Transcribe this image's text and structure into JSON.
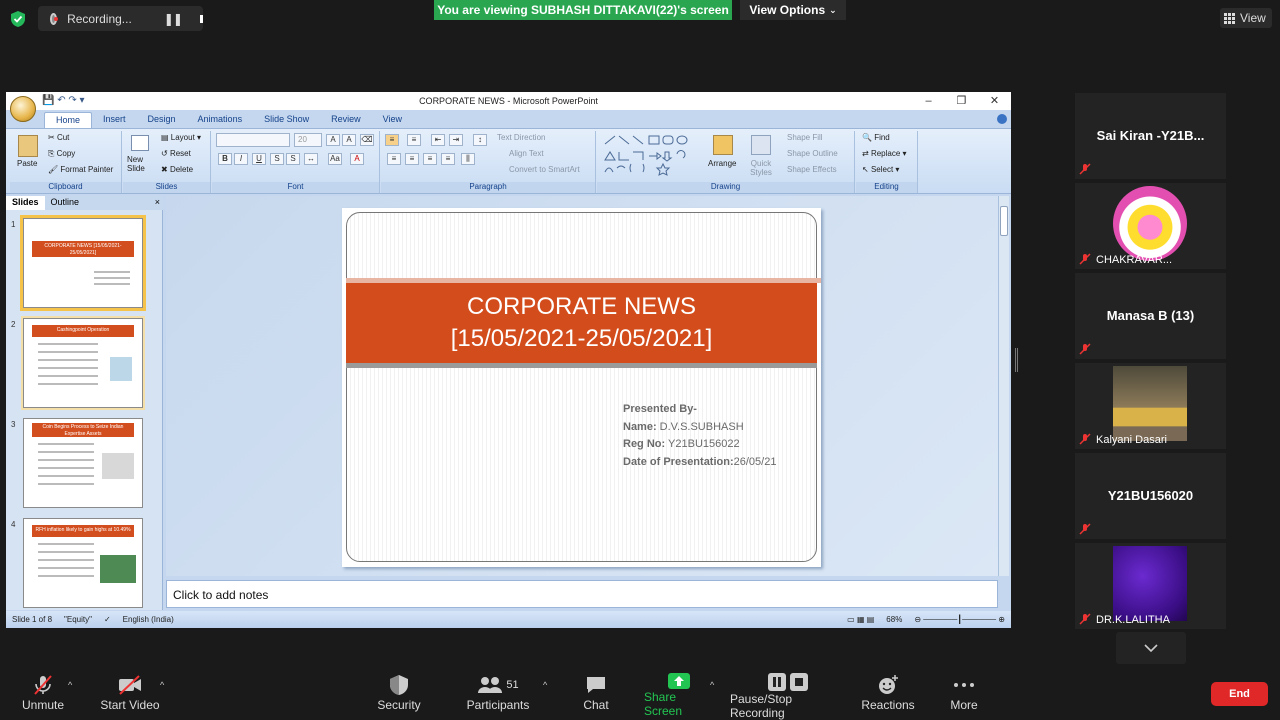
{
  "top": {
    "recording_label": "Recording...",
    "banner": "You are viewing SUBHASH DITTAKAVI(22)'s screen",
    "view_options": "View Options",
    "view": "View"
  },
  "ppt": {
    "window_title": "CORPORATE NEWS - Microsoft PowerPoint",
    "tabs": [
      "Home",
      "Insert",
      "Design",
      "Animations",
      "Slide Show",
      "Review",
      "View"
    ],
    "clipboard": {
      "paste": "Paste",
      "cut": "Cut",
      "copy": "Copy",
      "format_painter": "Format Painter",
      "label": "Clipboard"
    },
    "slides_grp": {
      "new_slide": "New Slide",
      "layout": "Layout",
      "reset": "Reset",
      "delete": "Delete",
      "label": "Slides"
    },
    "font_grp": {
      "size": "20",
      "label": "Font"
    },
    "paragraph_grp": {
      "text_direction": "Text Direction",
      "align_text": "Align Text",
      "convert": "Convert to SmartArt",
      "label": "Paragraph"
    },
    "drawing_grp": {
      "arrange": "Arrange",
      "quick_styles": "Quick Styles",
      "shape_fill": "Shape Fill",
      "shape_outline": "Shape Outline",
      "shape_effects": "Shape Effects",
      "label": "Drawing"
    },
    "editing_grp": {
      "find": "Find",
      "replace": "Replace",
      "select": "Select",
      "label": "Editing"
    },
    "pane_tabs": [
      "Slides",
      "Outline"
    ],
    "thumbs": [
      {
        "num": "1",
        "title": "CORPORATE NEWS [15/05/2021-25/05/2021]"
      },
      {
        "num": "2",
        "title": "Cashingpoint Operation"
      },
      {
        "num": "3",
        "title": "Coin Begins Process to Seize Indian Expertise Assets"
      },
      {
        "num": "4",
        "title": "RFH inflation likely to gain highs at 10.49%"
      }
    ],
    "slide": {
      "title_line1": "CORPORATE NEWS",
      "title_line2": "[15/05/2021-25/05/2021]",
      "presented_by": "Presented  By-",
      "name_label": "Name:",
      "name_value": " D.V.S.SUBHASH",
      "reg_label": "Reg No:",
      "reg_value": " Y21BU156022",
      "date_label": "Date of Presentation:",
      "date_value": "26/05/21"
    },
    "notes": "Click to add notes",
    "status": {
      "slide": "Slide 1 of 8",
      "theme": "\"Equity\"",
      "lang": "English (India)",
      "zoom": "68%"
    }
  },
  "gallery": [
    {
      "name": "Sai Kiran -Y21B...",
      "type": "name"
    },
    {
      "name": "CHAKRAVAR...",
      "type": "logo"
    },
    {
      "name": "Manasa B (13)",
      "type": "name"
    },
    {
      "name": "Kalyani Dasari",
      "type": "photo"
    },
    {
      "name": "Y21BU156020",
      "type": "name"
    },
    {
      "name": "DR.K.LALITHA",
      "type": "purple"
    }
  ],
  "toolbar": {
    "unmute": "Unmute",
    "start_video": "Start Video",
    "security": "Security",
    "participants": "Participants",
    "participants_count": "51",
    "chat": "Chat",
    "share_screen": "Share Screen",
    "pause_rec": "Pause/Stop Recording",
    "reactions": "Reactions",
    "more": "More",
    "end": "End"
  },
  "colors": {
    "banner": "#2aa651",
    "slide_band": "#d34c1c",
    "end": "#e02828",
    "share": "#23c552"
  }
}
